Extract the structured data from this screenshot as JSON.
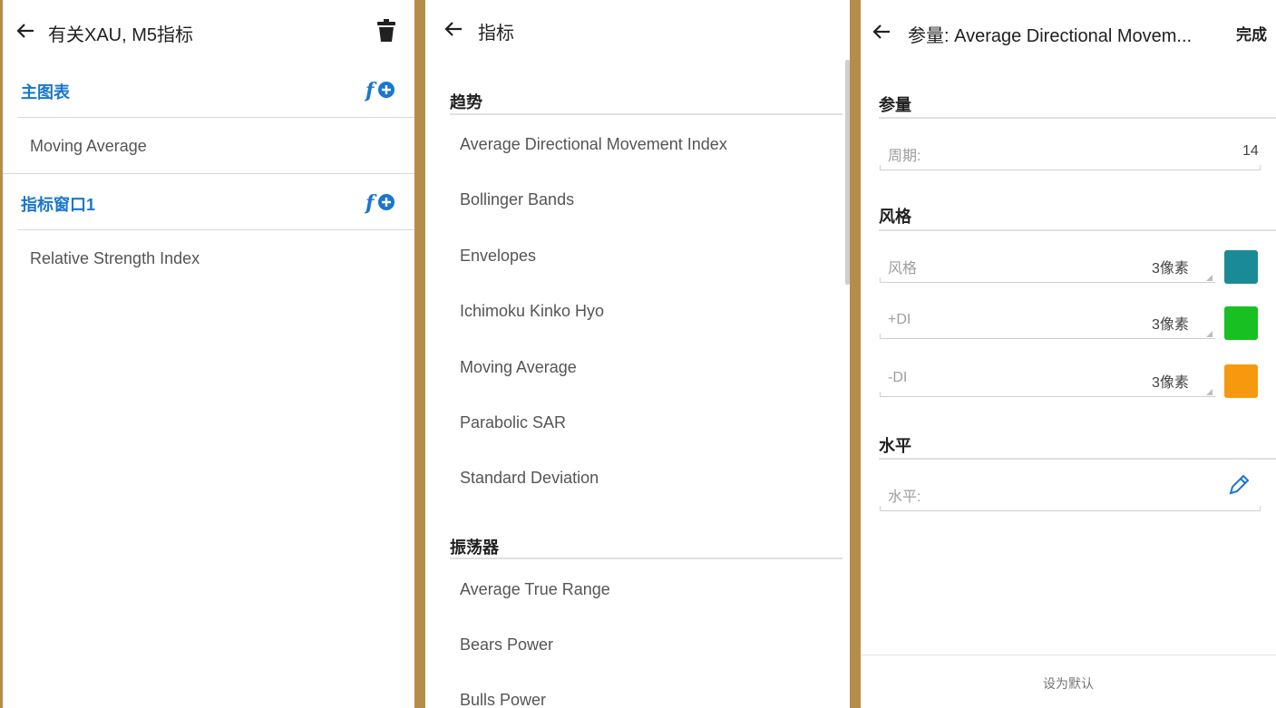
{
  "colors": {
    "accent_blue": "#1976d2",
    "divider_gold": "#b58d4a",
    "swatch_style": "#1a8b96",
    "swatch_plus_di": "#18c021",
    "swatch_minus_di": "#f7990e"
  },
  "left_panel": {
    "title": "有关XAU, M5指标",
    "sections": [
      {
        "label": "主图表",
        "items": [
          "Moving Average"
        ]
      },
      {
        "label": "指标窗口1",
        "items": [
          "Relative Strength Index"
        ]
      }
    ]
  },
  "middle_panel": {
    "title": "指标",
    "categories": [
      {
        "label": "趋势",
        "items": [
          "Average Directional Movement Index",
          "Bollinger Bands",
          "Envelopes",
          "Ichimoku Kinko Hyo",
          "Moving Average",
          "Parabolic SAR",
          "Standard Deviation"
        ]
      },
      {
        "label": "振荡器",
        "items": [
          "Average True Range",
          "Bears Power",
          "Bulls Power"
        ]
      }
    ]
  },
  "right_panel": {
    "title": "参量: Average Directional Movem...",
    "done_label": "完成",
    "params": {
      "label": "参量",
      "period_label": "周期:",
      "period_value": "14"
    },
    "style": {
      "label": "风格",
      "rows": [
        {
          "label": "风格",
          "value": "3像素"
        },
        {
          "label": "+DI",
          "value": "3像素"
        },
        {
          "label": "-DI",
          "value": "3像素"
        }
      ]
    },
    "levels": {
      "label": "水平",
      "field_label": "水平:"
    },
    "set_default_label": "设为默认"
  }
}
